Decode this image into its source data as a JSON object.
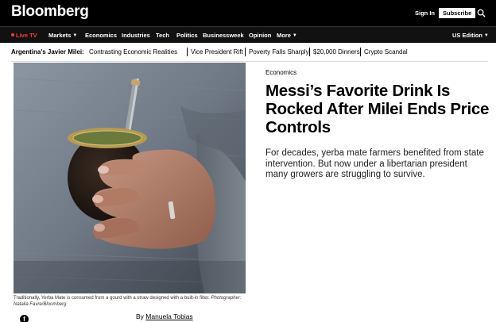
{
  "header": {
    "logo": "Bloomberg",
    "signin_label": "Sign In",
    "subscribe_label": "Subscribe"
  },
  "nav": {
    "live": "Live TV",
    "items": [
      "Markets",
      "Economics",
      "Industries",
      "Tech",
      "Politics",
      "Businessweek",
      "Opinion",
      "More"
    ],
    "edition": "US Edition"
  },
  "subnav": {
    "title": "Argentina's Javier Milei:",
    "items": [
      "Contrasting Economic Realities",
      "Vice President Rift",
      "Poverty Falls Sharply",
      "$20,000 Dinners",
      "Crypto Scandal"
    ]
  },
  "article": {
    "kicker": "Economics",
    "headline": "Messi’s Favorite Drink Is Rocked After Milei Ends Price Controls",
    "dek": "For decades, yerba mate farmers benefited from state intervention. But now under a libertarian president many growers are struggling to survive.",
    "caption": "Traditionally, Yerba Mate is consumed from a gourd with a straw designed with a built-in filter.",
    "credit": "Photographer: Natalia Favre/Bloomberg",
    "byline_prefix": "By",
    "author": "Manuela Tobias"
  },
  "icons": {
    "search": "search-icon",
    "chevron": "chevron-down-icon",
    "facebook": "facebook-icon"
  },
  "colors": {
    "header_bg": "#000000",
    "live_red": "#ff3b30"
  }
}
